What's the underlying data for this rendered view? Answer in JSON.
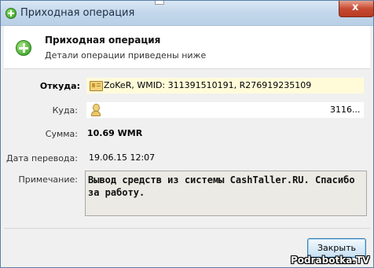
{
  "window": {
    "title": "Приходная операция",
    "close_label": "x"
  },
  "header": {
    "title": "Приходная операция",
    "subtitle": "Детали операции приведены ниже"
  },
  "fields": {
    "from_label": "Откуда:",
    "from_value": "ZoKeR, WMID: 311391510191, R276919235109",
    "to_label": "Куда:",
    "to_value": "3116...",
    "amount_label": "Сумма:",
    "amount_value": "10.69 WMR",
    "date_label": "Дата перевода:",
    "date_value": "19.06.15 12:07",
    "note_label": "Примечание:",
    "note_value": "Вывод средств из системы CashTaller.RU. Спасибо за работу."
  },
  "buttons": {
    "close_label": "Закрыть"
  },
  "watermark": "Podrabotka.TV",
  "icons": [
    "plus-circle-icon",
    "wm-passport-icon",
    "user-icon",
    "close-icon"
  ]
}
